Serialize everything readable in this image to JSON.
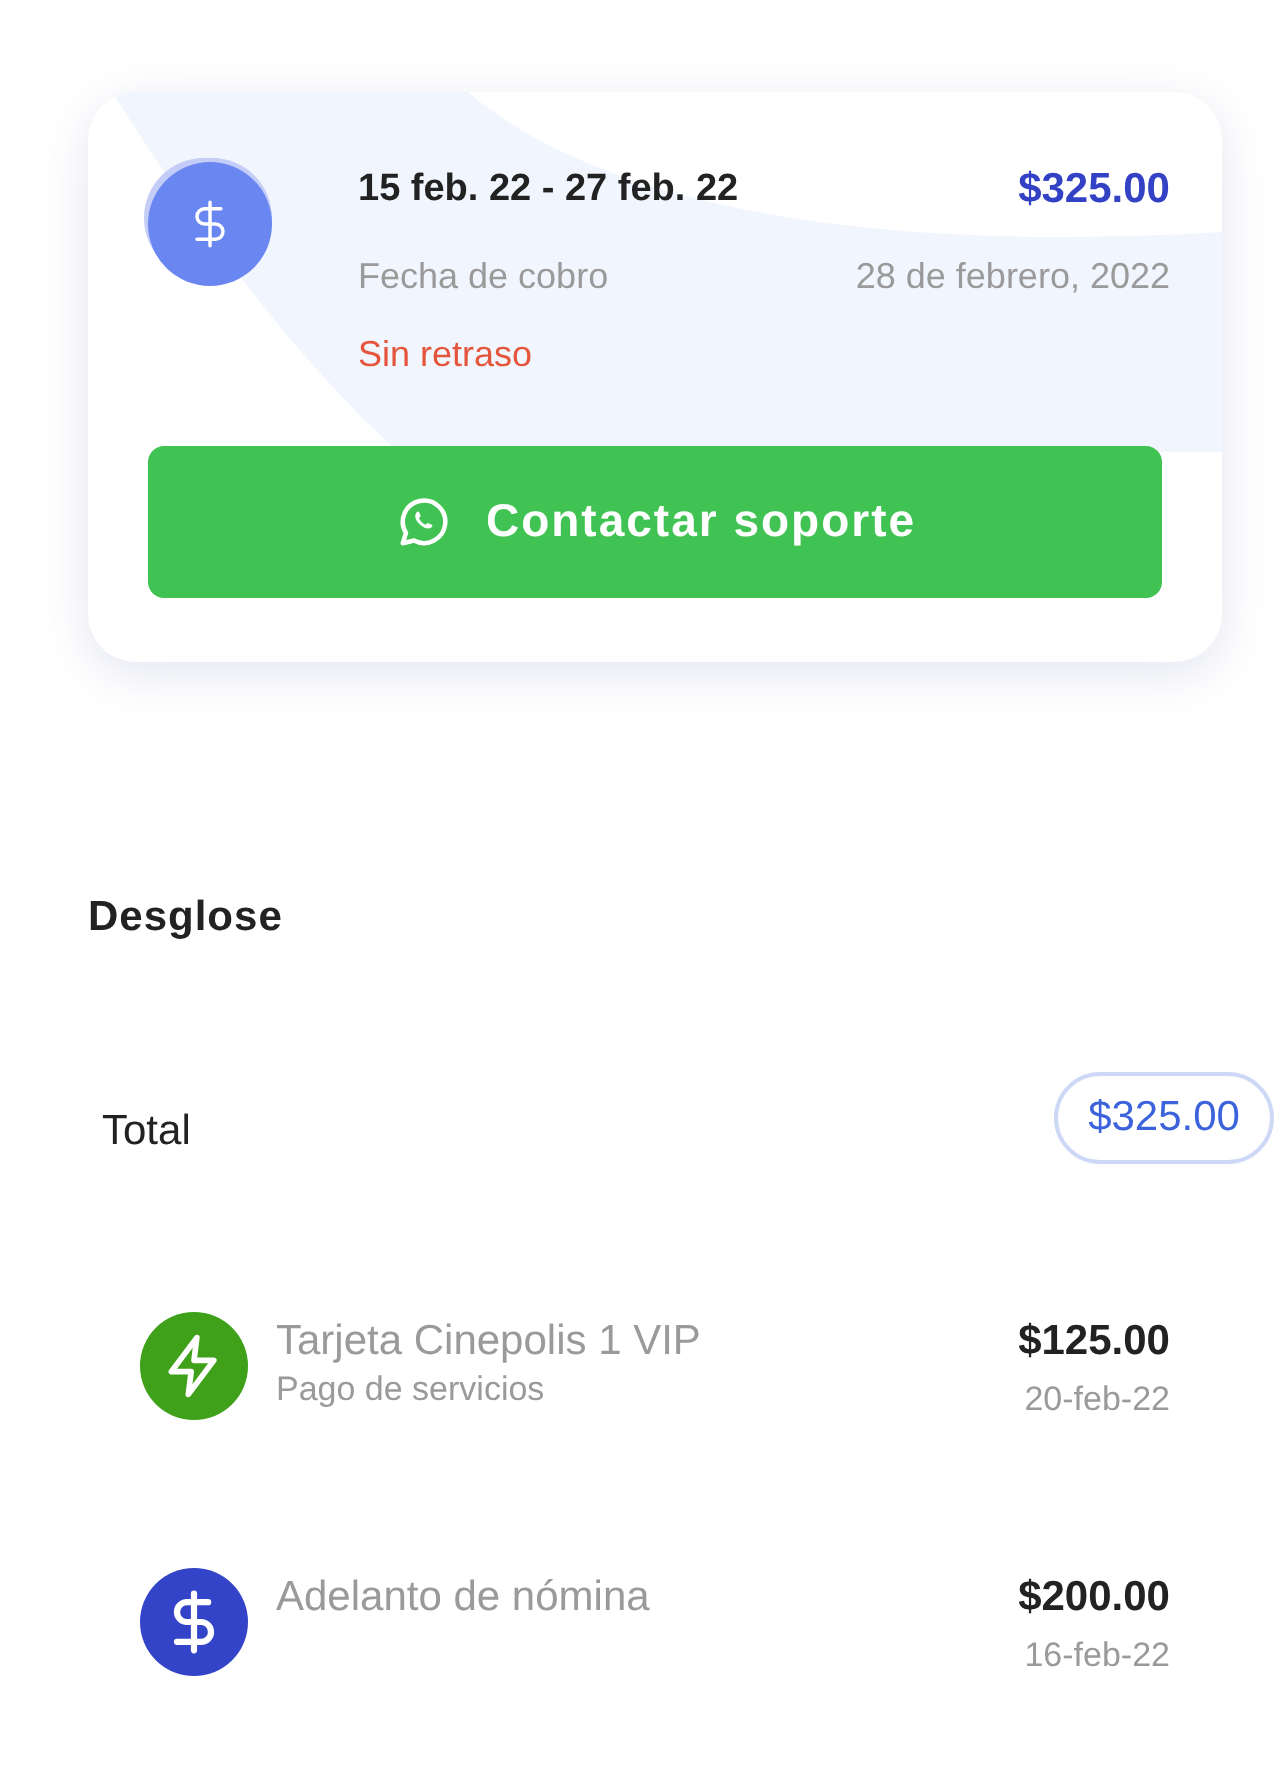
{
  "summary_card": {
    "period": "15 feb. 22 - 27 feb. 22",
    "amount": "$325.00",
    "charge_label": "Fecha de cobro",
    "charge_date": "28 de febrero, 2022",
    "status": "Sin retraso",
    "button": "Contactar soporte"
  },
  "section_title": "Desglose",
  "total": {
    "label": "Total",
    "amount": "$325.00"
  },
  "items": [
    {
      "kind": "service",
      "color": "#3fa119",
      "title": "Tarjeta Cinepolis 1 VIP",
      "subtitle": "Pago de servicios",
      "amount": "$125.00",
      "date": "20-feb-22"
    },
    {
      "kind": "advance",
      "color": "#3344c8",
      "title": "Adelanto de nómina",
      "amount": "$200.00",
      "date": "16-feb-22"
    }
  ]
}
